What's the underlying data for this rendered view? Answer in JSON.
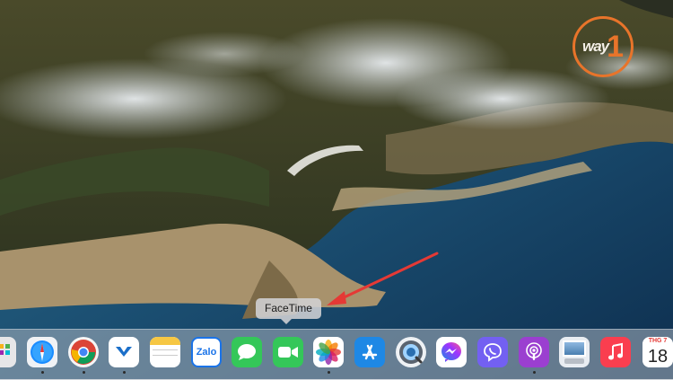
{
  "desktop": {
    "wallpaper": "big-sur-coastline",
    "watermark": {
      "text": "way",
      "number": "1",
      "accent": "#e8742a"
    }
  },
  "tooltip": {
    "label": "FaceTime"
  },
  "annotation": {
    "type": "arrow",
    "color": "#e53935",
    "target": "facetime-tooltip"
  },
  "dock": {
    "items": [
      {
        "name": "launchpad",
        "icon": "launchpad-icon",
        "running": false
      },
      {
        "name": "safari",
        "icon": "safari-icon",
        "running": true
      },
      {
        "name": "chrome",
        "icon": "chrome-icon",
        "running": true
      },
      {
        "name": "messenger-app",
        "icon": "blue-chevron-icon",
        "running": true
      },
      {
        "name": "notes",
        "icon": "notes-icon",
        "running": false
      },
      {
        "name": "zalo",
        "icon": "zalo-icon",
        "label": "Zalo",
        "running": false
      },
      {
        "name": "messages",
        "icon": "messages-icon",
        "running": false
      },
      {
        "name": "facetime",
        "icon": "facetime-icon",
        "running": false
      },
      {
        "name": "photos",
        "icon": "photos-icon",
        "running": true
      },
      {
        "name": "app-store",
        "icon": "app-store-icon",
        "running": false
      },
      {
        "name": "quicktime",
        "icon": "quicktime-icon",
        "running": false
      },
      {
        "name": "messenger",
        "icon": "messenger-icon",
        "running": false
      },
      {
        "name": "viber",
        "icon": "viber-icon",
        "running": false
      },
      {
        "name": "podcasts",
        "icon": "podcasts-icon",
        "running": true
      },
      {
        "name": "preview",
        "icon": "preview-icon",
        "running": false
      },
      {
        "name": "music",
        "icon": "music-icon",
        "running": false
      },
      {
        "name": "calendar",
        "icon": "calendar-icon",
        "month": "THG 7",
        "day": "18",
        "running": false
      }
    ]
  }
}
